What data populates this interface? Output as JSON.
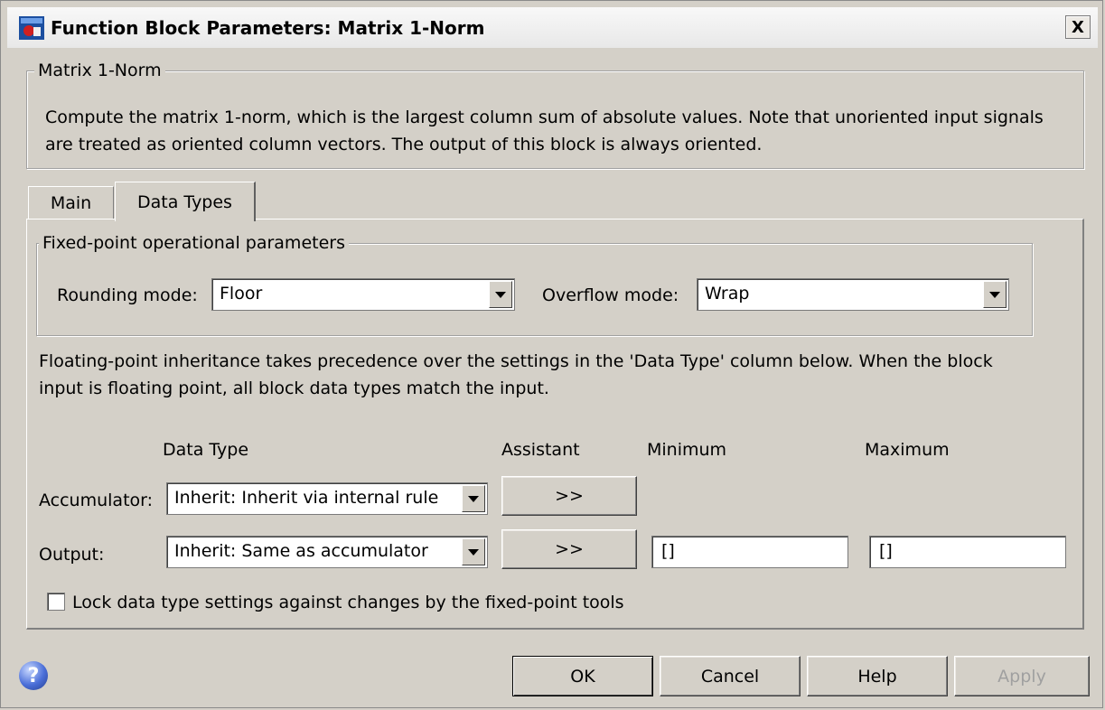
{
  "window": {
    "title": "Function Block Parameters: Matrix 1-Norm",
    "close_label": "X"
  },
  "block": {
    "name": "Matrix 1-Norm",
    "description_line1": "Compute the matrix 1-norm, which is the largest column sum of absolute values. Note that unoriented input signals",
    "description_line2": "are treated as oriented column vectors. The output of this block is always oriented."
  },
  "tabs": [
    {
      "label": "Main",
      "active": false
    },
    {
      "label": "Data Types",
      "active": true
    }
  ],
  "fixed_point": {
    "group_label": "Fixed-point operational parameters",
    "rounding_label": "Rounding mode:",
    "rounding_value": "Floor",
    "overflow_label": "Overflow mode:",
    "overflow_value": "Wrap"
  },
  "inheritance_note": {
    "line1": "Floating-point inheritance takes precedence over the settings in the 'Data Type' column below. When the block",
    "line2": "input is floating point, all block data types match the input."
  },
  "table": {
    "headers": {
      "data_type": "Data Type",
      "assistant": "Assistant",
      "minimum": "Minimum",
      "maximum": "Maximum"
    },
    "rows": [
      {
        "label": "Accumulator:",
        "data_type": "Inherit: Inherit via internal rule",
        "assistant": ">>"
      },
      {
        "label": "Output:",
        "data_type": "Inherit: Same as accumulator",
        "assistant": ">>",
        "minimum": "[]",
        "maximum": "[]"
      }
    ]
  },
  "lock": {
    "label": "Lock data type settings against changes by the fixed-point tools",
    "checked": false
  },
  "buttons": {
    "ok": "OK",
    "cancel": "Cancel",
    "help": "Help",
    "apply": "Apply"
  },
  "help_icon_glyph": "?",
  "colors": {
    "dialog_bg": "#d4d0c8",
    "help_icon": "#4a6ed8"
  }
}
